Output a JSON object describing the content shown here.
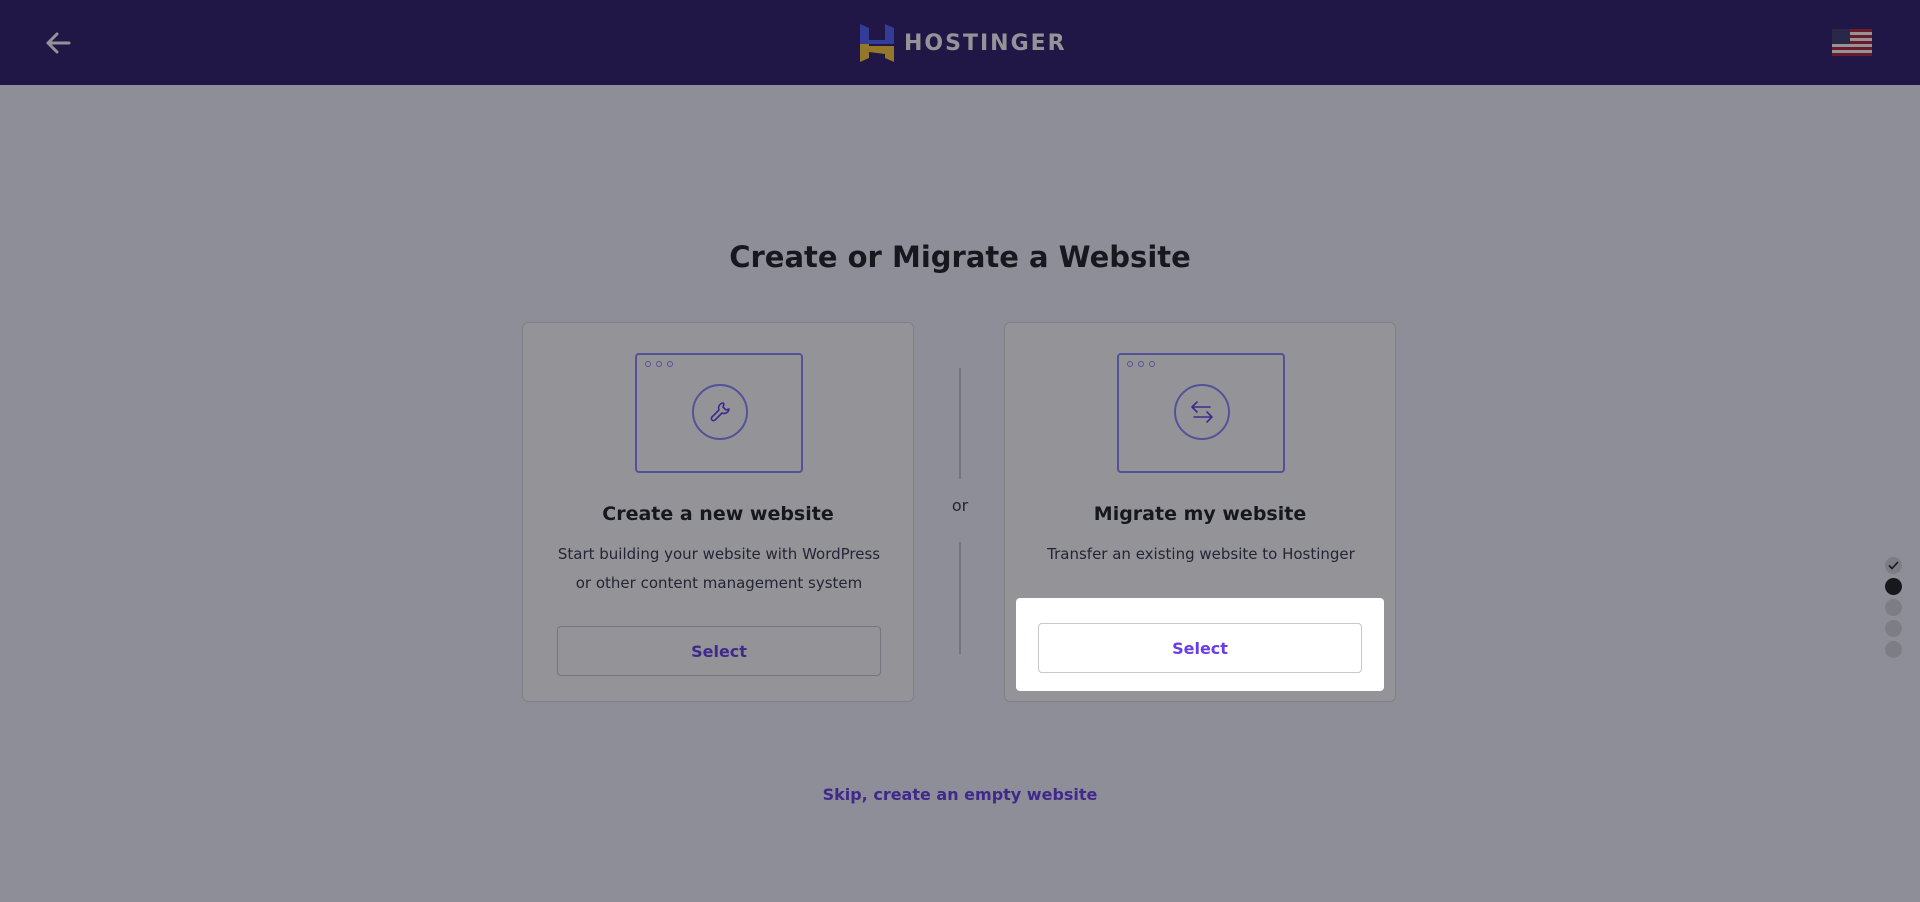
{
  "header": {
    "logo_text": "HOSTINGER",
    "back_icon": "arrow-left-icon",
    "flag_icon": "us-flag-icon",
    "colors": {
      "background": "#2f1c6a",
      "logo_blue": "#4f61ff",
      "logo_yellow": "#ffcd35"
    }
  },
  "page": {
    "title": "Create or Migrate a Website",
    "separator": "or",
    "skip_link": "Skip, create an empty website"
  },
  "cards": [
    {
      "title": "Create a new website",
      "description": "Start building your website with WordPress or other content management system",
      "button": "Select",
      "icon": "wrench-icon"
    },
    {
      "title": "Migrate my website",
      "description": "Transfer an existing website to Hostinger",
      "button": "Select",
      "icon": "transfer-arrows-icon"
    }
  ],
  "progress": {
    "total_steps": 5,
    "completed_steps": 1,
    "current_step": 2
  },
  "colors": {
    "accent": "#673de6",
    "illustration": "#8c85ff"
  }
}
